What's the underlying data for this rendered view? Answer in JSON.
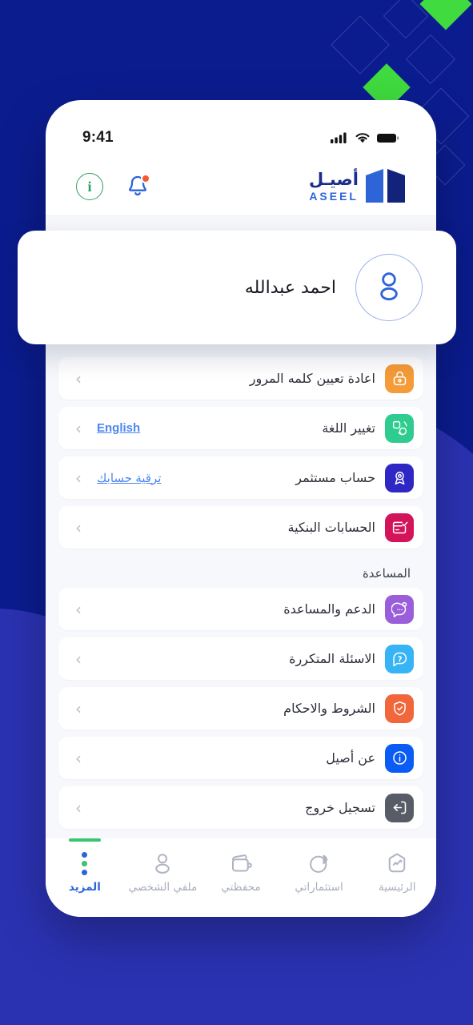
{
  "background": {
    "color_top": "#0B1C8F",
    "color_bottom": "#2B32B2",
    "accent_diamond": "#3FDB3F"
  },
  "status_bar": {
    "time": "9:41",
    "signal_icon": "cellular-signal-icon",
    "wifi_icon": "wifi-icon",
    "battery_icon": "battery-icon"
  },
  "app_header": {
    "info_icon": "info-circle-icon",
    "info_letter": "i",
    "notification_icon": "bell-icon",
    "has_notification_badge": true,
    "logo": {
      "arabic": "أصيـل",
      "latin": "ASEEL",
      "mark_icon": "aseel-building-logo",
      "color_primary": "#2D64D8",
      "color_dark": "#1B2C8A"
    }
  },
  "profile_card": {
    "name": "احمد عبدالله",
    "avatar_icon": "user-avatar-icon",
    "avatar_border_color": "#9BB2E8"
  },
  "menu": {
    "account_items": [
      {
        "label": "اعادة تعيين كلمه المرور",
        "icon": "lock-reset-icon",
        "icon_bg": "#F59B37",
        "link": "",
        "chevron": "‹"
      },
      {
        "label": "تغيير اللغة",
        "icon": "language-switch-icon",
        "icon_bg": "#2ECC8F",
        "link": "English",
        "chevron": "‹"
      },
      {
        "label": "حساب مستثمر",
        "icon": "investor-badge-icon",
        "icon_bg": "#2E27C4",
        "link": "ترقية حسابك",
        "chevron": "‹"
      },
      {
        "label": "الحسابات البنكية",
        "icon": "bank-card-check-icon",
        "icon_bg": "#D4145A",
        "link": "",
        "chevron": "‹"
      }
    ],
    "help_section_title": "المساعدة",
    "help_items": [
      {
        "label": "الدعم والمساعدة",
        "icon": "support-chat-icon",
        "icon_bg": "#9B5EDB",
        "link": "",
        "chevron": "‹"
      },
      {
        "label": "الاسئلة المتكررة",
        "icon": "faq-question-icon",
        "icon_bg": "#36B4F5",
        "link": "",
        "chevron": "‹"
      },
      {
        "label": "الشروط والاحكام",
        "icon": "shield-check-icon",
        "icon_bg": "#F1663A",
        "link": "",
        "chevron": "‹"
      },
      {
        "label": "عن أصيل",
        "icon": "info-circle-icon",
        "icon_bg": "#0B5CF5",
        "link": "",
        "chevron": "‹"
      },
      {
        "label": "تسجيل خروج",
        "icon": "logout-icon",
        "icon_bg": "#585C66",
        "link": "",
        "chevron": "‹"
      }
    ]
  },
  "bottom_nav": {
    "active_index": 4,
    "indicator_color": "#39C46E",
    "active_color": "#2D64D8",
    "items": [
      {
        "label": "الرئيسية",
        "icon": "home-chart-icon"
      },
      {
        "label": "استثماراتي",
        "icon": "pie-chart-icon"
      },
      {
        "label": "محفظتي",
        "icon": "wallet-icon"
      },
      {
        "label": "ملفي الشخصي",
        "icon": "user-profile-icon"
      },
      {
        "label": "المزيد",
        "icon": "more-dots-icon"
      }
    ]
  }
}
